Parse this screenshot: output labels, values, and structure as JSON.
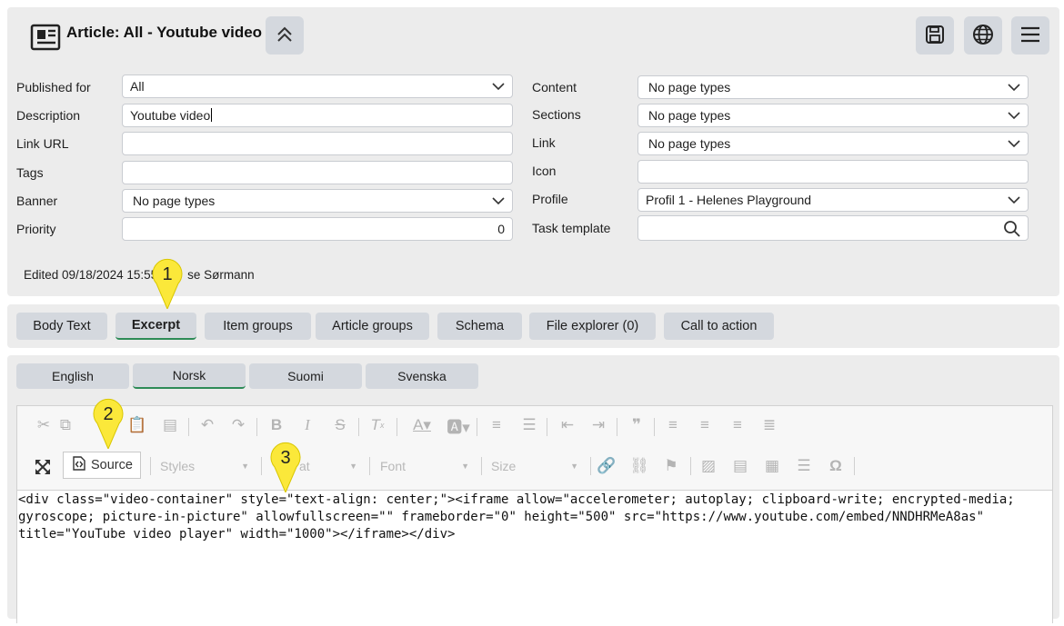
{
  "header": {
    "title": "Article: All - Youtube video",
    "icons": [
      "newspaper-icon",
      "collapse-chevrons-icon",
      "save-icon",
      "globe-icon",
      "menu-icon"
    ]
  },
  "form": {
    "left": [
      {
        "label": "Published for",
        "value": "All",
        "type": "select"
      },
      {
        "label": "Description",
        "value": "Youtube video",
        "type": "text"
      },
      {
        "label": "Link URL",
        "value": "",
        "type": "text"
      },
      {
        "label": "Tags",
        "value": "",
        "type": "text"
      },
      {
        "label": "Banner",
        "value": "No page types",
        "type": "select"
      },
      {
        "label": "Priority",
        "value": "0",
        "type": "number"
      }
    ],
    "right": [
      {
        "label": "Content",
        "value": "No page types",
        "type": "select"
      },
      {
        "label": "Sections",
        "value": "No page types",
        "type": "select"
      },
      {
        "label": "Link",
        "value": "No page types",
        "type": "select"
      },
      {
        "label": "Icon",
        "value": "",
        "type": "text"
      },
      {
        "label": "Profile",
        "value": "Profil 1 - Helenes Playground",
        "type": "select"
      },
      {
        "label": "Task template",
        "value": "",
        "type": "search"
      }
    ]
  },
  "edited": {
    "prefix": "Edited 09/18/2024 15:55",
    "suffix": "se Sørmann"
  },
  "tabs": [
    {
      "label": "Body Text",
      "active": false
    },
    {
      "label": "Excerpt",
      "active": true
    },
    {
      "label": "Item groups",
      "active": false
    },
    {
      "label": "Article groups",
      "active": false
    },
    {
      "label": "Schema",
      "active": false
    },
    {
      "label": "File explorer (0)",
      "active": false
    },
    {
      "label": "Call to action",
      "active": false
    }
  ],
  "languages": [
    {
      "label": "English",
      "active": false
    },
    {
      "label": "Norsk",
      "active": true
    },
    {
      "label": "Suomi",
      "active": false
    },
    {
      "label": "Svenska",
      "active": false
    }
  ],
  "editor": {
    "source_label": "Source",
    "styles_label": "Styles",
    "format_label": "at",
    "font_label": "Font",
    "size_label": "Size",
    "code": "<div class=\"video-container\" style=\"text-align: center;\"><iframe allow=\"accelerometer; autoplay; clipboard-write; encrypted-media; gyroscope; picture-in-picture\" allowfullscreen=\"\" frameborder=\"0\" height=\"500\" src=\"https://www.youtube.com/embed/NNDHRMeA8as\" title=\"YouTube video player\" width=\"1000\"></iframe></div>"
  },
  "callouts": [
    "1",
    "2",
    "3"
  ],
  "colors": {
    "panel": "#ececec",
    "button": "#d4d8de",
    "active_underline": "#2e8b57",
    "callout": "#fbe83a"
  }
}
